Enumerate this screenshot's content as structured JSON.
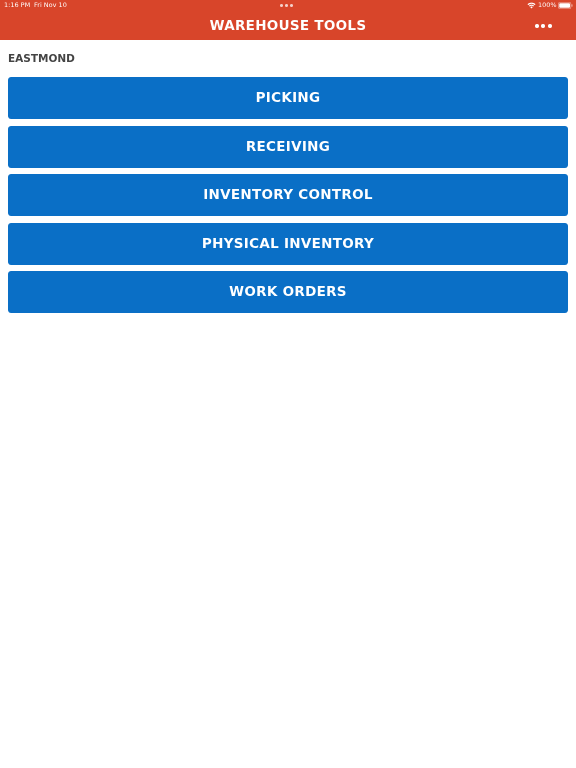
{
  "status_bar": {
    "time": "1:16 PM",
    "date": "Fri Nov 10",
    "battery_percent": "100%",
    "wifi_icon": "wifi-icon",
    "battery_icon": "battery-icon"
  },
  "header": {
    "title": "WAREHOUSE TOOLS",
    "menu_icon": "more-horizontal-icon",
    "background_color": "#d8452a"
  },
  "location": "EASTMOND",
  "menu": {
    "button_color": "#0a6fc6",
    "items": [
      {
        "label": "PICKING"
      },
      {
        "label": "RECEIVING"
      },
      {
        "label": "INVENTORY CONTROL"
      },
      {
        "label": "PHYSICAL INVENTORY"
      },
      {
        "label": "WORK ORDERS"
      }
    ]
  }
}
